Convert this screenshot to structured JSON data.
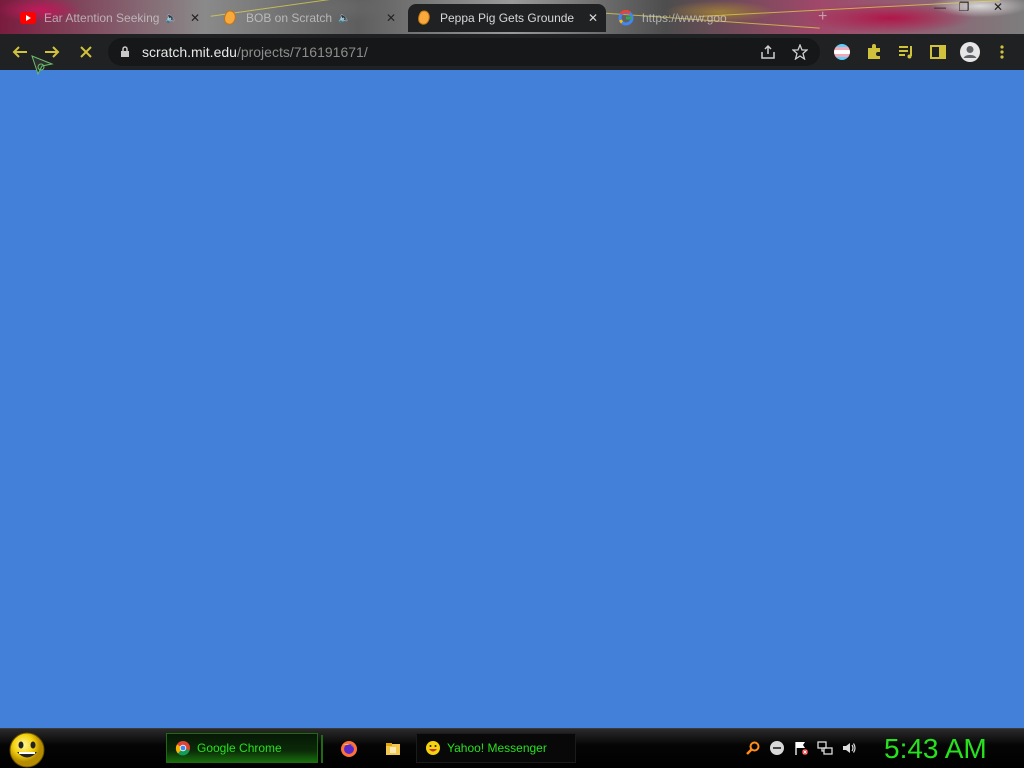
{
  "browser": {
    "tabs": [
      {
        "title": "Ear Attention Seeking",
        "favicon": "youtube-icon",
        "state": "inactive",
        "audio": true
      },
      {
        "title": "BOB on Scratch",
        "favicon": "scratch-icon",
        "state": "inactive",
        "audio": true
      },
      {
        "title": "Peppa Pig Gets Grounde",
        "favicon": "scratch-icon",
        "state": "active",
        "audio": false
      },
      {
        "title": "https://www.goo",
        "favicon": "google-icon",
        "state": "inactive",
        "audio": false
      }
    ],
    "address": {
      "host": "scratch.mit.edu",
      "path": "/projects/716191671/"
    },
    "loading": true,
    "page_background": "#4380d9"
  },
  "taskbar": {
    "items": [
      {
        "label": "Google Chrome",
        "icon": "chrome-icon"
      },
      {
        "label": "Yahoo! Messenger",
        "icon": "smiley-icon"
      }
    ],
    "quick_launch": [
      "firefox-icon",
      "folder-icon"
    ],
    "tray": [
      "search-icon",
      "status-icon",
      "flag-icon",
      "network-icon",
      "volume-icon"
    ],
    "clock": "5:43 AM",
    "accent": "#27e11e"
  }
}
